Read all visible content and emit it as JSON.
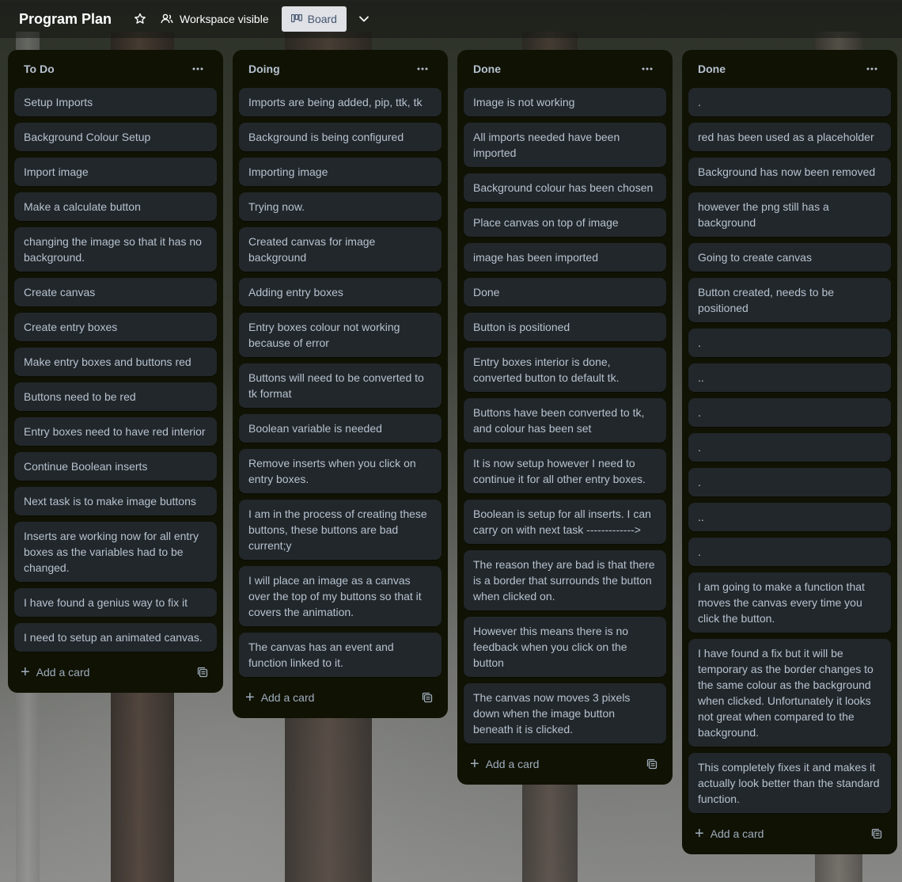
{
  "header": {
    "board_title": "Program Plan",
    "visibility_label": "Workspace visible",
    "view_label": "Board",
    "icons": [
      "star-icon",
      "people-icon",
      "board-icon",
      "chevron-down-icon"
    ]
  },
  "lists": [
    {
      "title": "To Do",
      "cards": [
        "Setup Imports",
        "Background Colour Setup",
        "Import image",
        "Make a calculate button",
        "changing the image so that it has no background.",
        "Create canvas",
        "Create entry boxes",
        "Make entry boxes and buttons red",
        "Buttons need to be red",
        "Entry boxes need to have red interior",
        "Continue Boolean inserts",
        "Next task is to make image buttons",
        "Inserts are working now for all entry boxes as the variables had to be changed.",
        "I have found a genius way to fix it",
        "I need to setup an animated canvas."
      ],
      "add_label": "Add a card"
    },
    {
      "title": "Doing",
      "cards": [
        "Imports are being added, pip, ttk, tk",
        "Background is being configured",
        "Importing image",
        "Trying now.",
        "Created canvas for image background",
        "Adding entry boxes",
        "Entry boxes colour not working because of error",
        "Buttons will need to be converted to tk format",
        "Boolean variable is needed",
        "Remove inserts when you click on entry boxes.",
        "I am in the process of creating these buttons, these buttons are bad current;y",
        "I will place an image as a canvas over the top of my buttons so that it covers the animation.",
        "The canvas has an event and function linked to it."
      ],
      "add_label": "Add a card"
    },
    {
      "title": "Done",
      "cards": [
        "Image is not working",
        "All imports needed have been imported",
        "Background colour has been chosen",
        "Place canvas on top of image",
        "image has been imported",
        "Done",
        "Button is positioned",
        "Entry boxes interior is done, converted button to default tk.",
        "Buttons have been converted to tk, and colour has been set",
        "It is now setup however I need to continue it for all other entry boxes.",
        "Boolean is setup for all inserts. I can carry on with next task ------------->",
        "The reason they are bad is that there is a border that surrounds the button when clicked on.",
        "However this means there is no feedback when you click on the button",
        "The canvas now moves 3 pixels down when the image button beneath it is clicked."
      ],
      "add_label": "Add a card"
    },
    {
      "title": "Done",
      "cards": [
        ".",
        "red has been used as a placeholder",
        "Background has now been removed",
        "however the png still has a background",
        "Going to create canvas",
        "Button created, needs to be positioned",
        ".",
        "..",
        ".",
        ".",
        ".",
        "..",
        ".",
        "I am going to make a function that moves the canvas every time you click the button.",
        "I have found a fix but it will be temporary as the border changes to the same colour as the background when clicked. Unfortunately it looks not great when compared to the background.",
        "This completely fixes it and makes it actually look better than the standard function."
      ],
      "add_label": "Add a card"
    }
  ]
}
